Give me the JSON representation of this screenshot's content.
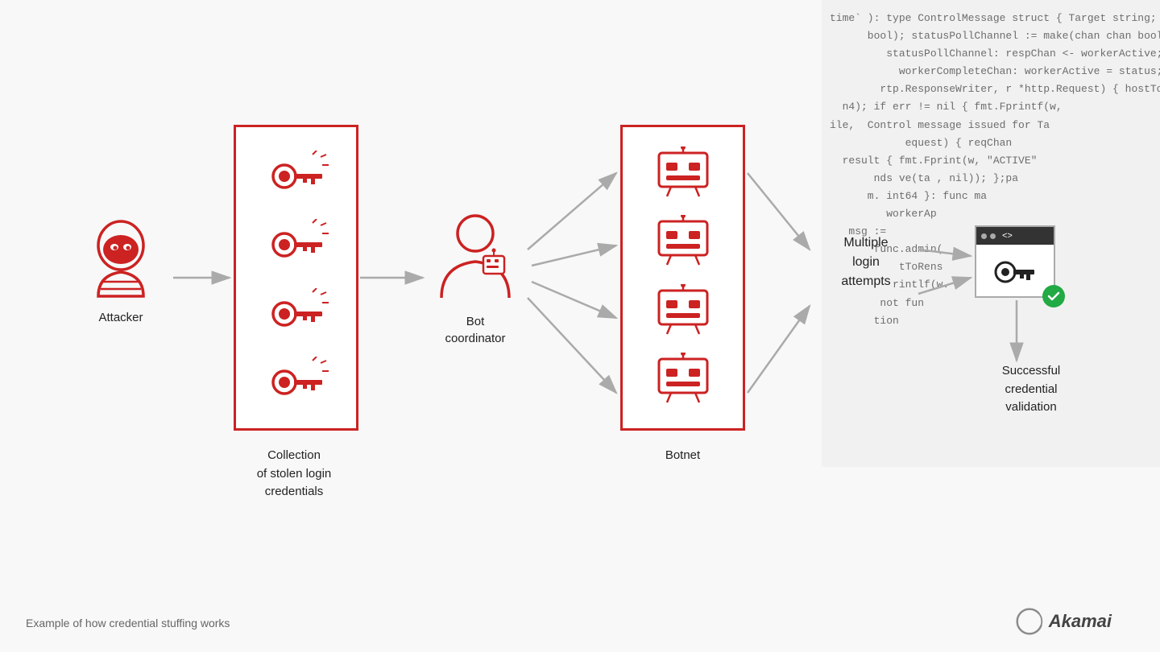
{
  "code_lines": [
    "time` ): type ControlMessage struct { Target string; Co",
    "      bool); statusPollChannel := make(chan chan bool); v",
    "         statusPollChannel: respChan <- workerActive; case",
    "           workerCompleteChan: workerActive = status;",
    "        rtp.ResponseWriter, r *http.Request) { hostTo",
    "  n4); if err != nil { fmt.Fprintf(w,",
    "ile,  Control message issued for Ta",
    "            equest) { reqChan",
    "  result { fmt.Fprint(w, \"ACTIVE\"",
    "       nds ve(ta , nil)); };pa",
    "      m. int64 }: func ma",
    "         workerAp",
    "   msg :=",
    "       func.admin(",
    "           tToRens",
    "          rintlf(w.",
    "        not fun",
    "       tion"
  ],
  "attacker_label": "Attacker",
  "credentials_label": "Collection\nof stolen login\ncredentials",
  "bot_coordinator_label": "Bot\ncoordinator",
  "botnet_label": "Botnet",
  "multiple_login_label": "Multiple\nlogin\nattempts",
  "successful_label": "Successful\ncredential\nvalidation",
  "bottom_caption": "Example of how credential stuffing works",
  "akamai_text": "Akamai",
  "colors": {
    "red": "#cc2222",
    "gray": "#999",
    "arrow_gray": "#aaa",
    "dark": "#222"
  }
}
